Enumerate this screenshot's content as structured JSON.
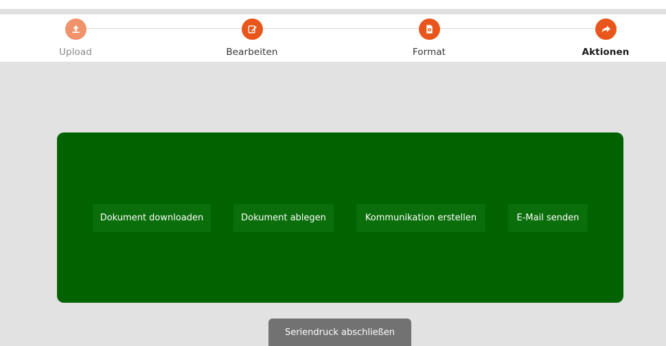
{
  "stepper": {
    "steps": [
      {
        "label": "Upload",
        "icon": "upload-icon",
        "state": "done"
      },
      {
        "label": "Bearbeiten",
        "icon": "edit-icon",
        "state": "done"
      },
      {
        "label": "Format",
        "icon": "format-icon",
        "state": "done"
      },
      {
        "label": "Aktionen",
        "icon": "share-arrow-icon",
        "state": "active"
      }
    ]
  },
  "actions": {
    "buttons": [
      {
        "label": "Dokument downloaden"
      },
      {
        "label": "Dokument ablegen"
      },
      {
        "label": "Kommunikation erstellen"
      },
      {
        "label": "E-Mail senden"
      }
    ]
  },
  "footer": {
    "finish_label": "Seriendruck abschließen"
  },
  "colors": {
    "accent": "#e8561b",
    "accent_done": "#f0926a",
    "panel": "#006300",
    "button": "#0a6e0a",
    "background": "#e2e2e2",
    "finish_button": "#727272"
  }
}
